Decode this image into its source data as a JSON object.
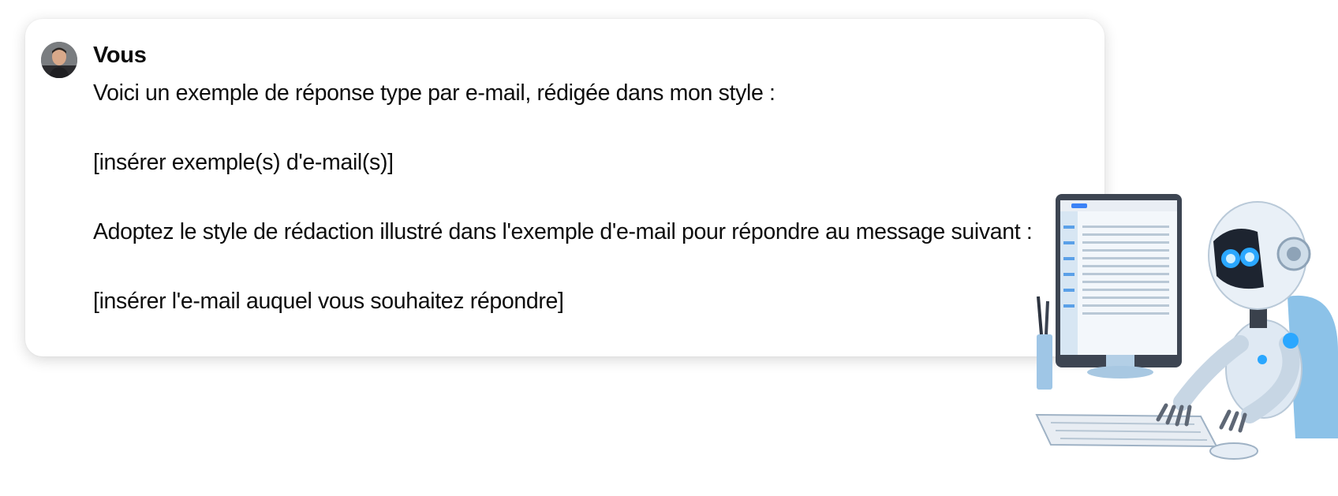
{
  "message": {
    "author": "Vous",
    "lines": [
      "Voici un exemple de réponse type par e-mail, rédigée dans mon style :",
      "[insérer exemple(s) d'e-mail(s)]",
      "Adoptez le style de rédaction illustré dans l'exemple d'e-mail pour répondre au message suivant :",
      "[insérer l'e-mail auquel vous souhaitez répondre]"
    ]
  },
  "illustration": {
    "icon": "robot-at-computer-illustration",
    "accent": "#2aa7ff"
  }
}
